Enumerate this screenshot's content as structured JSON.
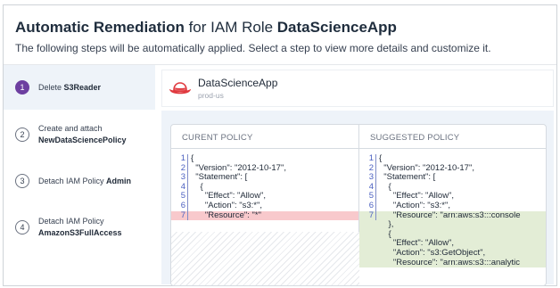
{
  "header": {
    "title_bold1": "Automatic Remediation",
    "title_mid": " for IAM Role ",
    "title_bold2": "DataScienceApp",
    "subtitle": "The following steps will be automatically applied. Select a step to view more details and customize it."
  },
  "steps": [
    {
      "num": "1",
      "prefix": "Delete ",
      "strong": "S3Reader",
      "line2": "",
      "active": true
    },
    {
      "num": "2",
      "prefix": "Create and attach",
      "strong": "NewDataSciencePolicy",
      "line2": "",
      "active": false
    },
    {
      "num": "3",
      "prefix": "Detach IAM Policy ",
      "strong": "Admin",
      "line2": "",
      "active": false
    },
    {
      "num": "4",
      "prefix": "Detach IAM Policy",
      "strong": "AmazonS3FullAccess",
      "line2": "",
      "active": false
    }
  ],
  "resource": {
    "name": "DataScienceApp",
    "region": "prod-us",
    "icon": "red-hat-icon"
  },
  "policies": {
    "current_title": "CURENT POLICY",
    "suggested_title": "SUGGESTED POLICY",
    "current_lines": [
      {
        "n": "1",
        "t": "{"
      },
      {
        "n": "2",
        "t": "  \"Version\": \"2012-10-17\","
      },
      {
        "n": "3",
        "t": "  \"Statement\": ["
      },
      {
        "n": "4",
        "t": "    {"
      },
      {
        "n": "5",
        "t": "      \"Effect\": \"Allow\","
      },
      {
        "n": "6",
        "t": "      \"Action\": \"s3:*\","
      },
      {
        "n": "7",
        "t": "      \"Resource\": \"*\"",
        "state": "removed"
      }
    ],
    "suggested_lines": [
      {
        "n": "1",
        "t": "{"
      },
      {
        "n": "2",
        "t": "  \"Version\": \"2012-10-17\","
      },
      {
        "n": "3",
        "t": "  \"Statement\": ["
      },
      {
        "n": "4",
        "t": "    {"
      },
      {
        "n": "5",
        "t": "      \"Effect\": \"Allow\","
      },
      {
        "n": "6",
        "t": "      \"Action\": \"s3:*\","
      },
      {
        "n": "7",
        "t": "      \"Resource\": \"arn:aws:s3:::console",
        "state": "added"
      },
      {
        "n": "",
        "t": "    },",
        "state": "added"
      },
      {
        "n": "",
        "t": "    {",
        "state": "added"
      },
      {
        "n": "",
        "t": "      \"Effect\": \"Allow\",",
        "state": "added"
      },
      {
        "n": "",
        "t": "      \"Action\": \"s3:GetObject\",",
        "state": "added"
      },
      {
        "n": "",
        "t": "      \"Resource\": \"arn:aws:s3:::analytic",
        "state": "added"
      }
    ]
  },
  "colors": {
    "accent_purple": "#6d3fa0",
    "removed_bg": "#f8c9cc",
    "added_bg": "#e3edd6",
    "hat_red": "#e0393e"
  }
}
